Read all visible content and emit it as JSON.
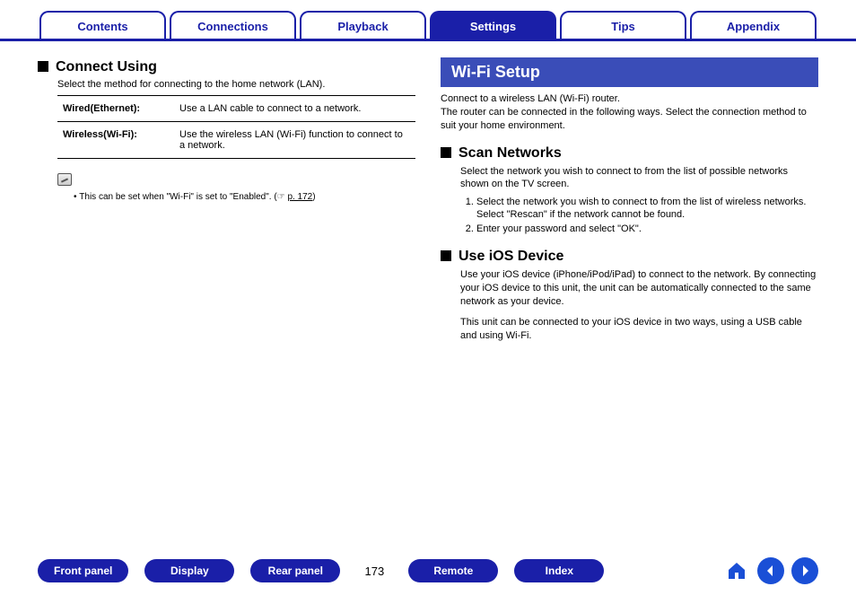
{
  "tabs": {
    "contents": "Contents",
    "connections": "Connections",
    "playback": "Playback",
    "settings": "Settings",
    "tips": "Tips",
    "appendix": "Appendix",
    "active": "settings"
  },
  "left": {
    "connect_using": {
      "title": "Connect Using",
      "desc": "Select the method for connecting to the home network (LAN).",
      "rows": [
        {
          "k": "Wired(Ethernet):",
          "v": "Use a LAN cable to connect to a network."
        },
        {
          "k": "Wireless(Wi-Fi):",
          "v": "Use the wireless LAN (Wi-Fi) function to connect to a network."
        }
      ],
      "note_prefix": "This can be set when \"Wi-Fi\" is set to \"Enabled\".  (",
      "note_hand": "☞",
      "note_link": "p. 172",
      "note_suffix": ")"
    }
  },
  "right": {
    "banner": "Wi-Fi Setup",
    "intro1": "Connect to a wireless LAN (Wi-Fi) router.",
    "intro2": "The router can be connected in the following ways. Select the connection method to suit your home environment.",
    "scan": {
      "title": "Scan Networks",
      "desc": "Select the network you wish to connect to from the list of possible networks shown on the TV screen.",
      "step1": "Select the network you wish to connect to from the list of wireless networks.",
      "step1b": "Select \"Rescan\" if the network cannot be found.",
      "step2": "Enter your password and select \"OK\"."
    },
    "ios": {
      "title": "Use iOS Device",
      "p1": "Use your iOS device (iPhone/iPod/iPad) to connect to the network. By connecting your iOS device to this unit, the unit can be automatically connected to the same network as your device.",
      "p2": "This unit can be connected to your iOS device in two ways, using a USB cable and using Wi-Fi."
    }
  },
  "footer": {
    "front_panel": "Front panel",
    "display": "Display",
    "rear_panel": "Rear panel",
    "page": "173",
    "remote": "Remote",
    "index": "Index"
  }
}
